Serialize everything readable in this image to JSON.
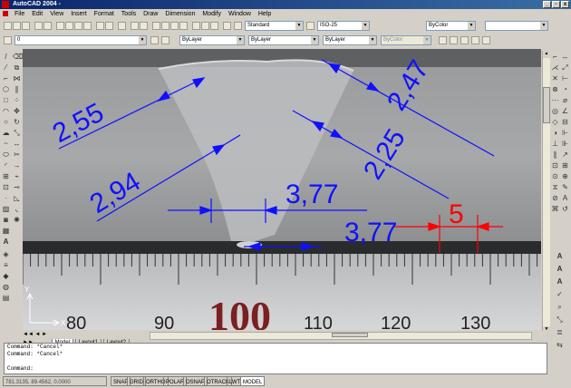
{
  "window": {
    "title": "AutoCAD 2004 -",
    "buttons": [
      "_",
      "▫",
      "x"
    ]
  },
  "menu": [
    "File",
    "Edit",
    "View",
    "Insert",
    "Format",
    "Tools",
    "Draw",
    "Dimension",
    "Modify",
    "Window",
    "Help"
  ],
  "styles": {
    "text_style": "Standard",
    "dim_style": "ISO-25"
  },
  "properties": {
    "layer": "0",
    "color": "ByLayer",
    "linetype": "ByLayer",
    "lineweight": "ByLayer",
    "plotstyle": "ByColor"
  },
  "dimensions": [
    "2,55",
    "2,94",
    "3,77",
    "3,77",
    "2,47",
    "2,25",
    "5"
  ],
  "ruler_labels": [
    "80",
    "90",
    "100",
    "110",
    "120",
    "130"
  ],
  "tabs": [
    "Model",
    "Layout1",
    "Layout2"
  ],
  "command_lines": [
    "Command: *Cancel*",
    "Command: *Cancel*",
    "Command:"
  ],
  "status": {
    "coords": "781.3135, 89.4562, 0.0000",
    "buttons": [
      "SNAP",
      "GRID",
      "ORTHO",
      "POLAR",
      "OSNAP",
      "OTRACK",
      "LWT",
      "MODEL"
    ]
  },
  "colors": {
    "dimension": "#1010ff",
    "highlight": "#ff0000",
    "titlebar": "#0a246a"
  }
}
